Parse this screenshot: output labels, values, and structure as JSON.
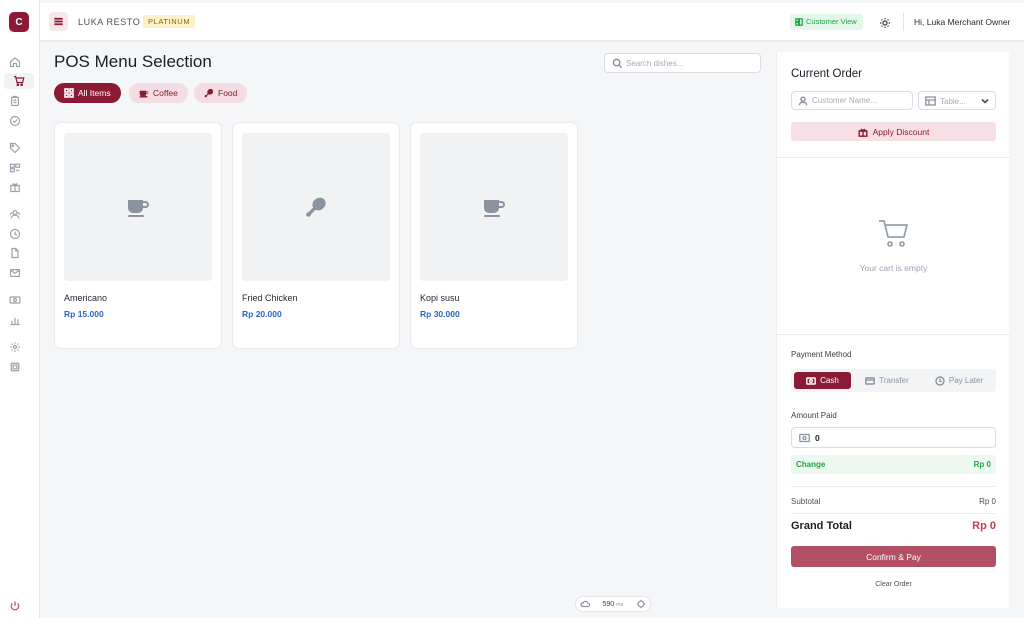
{
  "app": {
    "logo_letter": "C",
    "brand": "LUKA RESTO",
    "tier": "PLATINUM",
    "customer_view": "Customer View",
    "greeting": "Hi, Luka Merchant Owner"
  },
  "sidebar": {
    "items": [
      {
        "icon": "home-icon"
      },
      {
        "icon": "cart-icon",
        "active": true
      },
      {
        "icon": "clipboard-icon"
      },
      {
        "icon": "check-circle-icon"
      },
      {
        "icon": "tag-icon"
      },
      {
        "icon": "grid-icon"
      },
      {
        "icon": "gift-icon"
      },
      {
        "icon": "users-icon"
      },
      {
        "icon": "clock-icon"
      },
      {
        "icon": "document-icon"
      },
      {
        "icon": "mail-icon"
      },
      {
        "icon": "cash-icon"
      },
      {
        "icon": "bar-chart-icon"
      },
      {
        "icon": "settings-icon"
      },
      {
        "icon": "chip-icon"
      },
      {
        "icon": "power-icon"
      }
    ]
  },
  "main": {
    "title": "POS Menu Selection",
    "search_placeholder": "Search dishes...",
    "categories": [
      {
        "label": "All Items",
        "icon": "grid-icon",
        "active": true
      },
      {
        "label": "Coffee",
        "icon": "coffee-icon",
        "active": false
      },
      {
        "label": "Food",
        "icon": "drumstick-icon",
        "active": false
      }
    ],
    "products": [
      {
        "name": "Americano",
        "price": "Rp 15.000",
        "icon": "coffee-icon"
      },
      {
        "name": "Fried Chicken",
        "price": "Rp 20.000",
        "icon": "drumstick-icon"
      },
      {
        "name": "Kopi susu",
        "price": "Rp 30.000",
        "icon": "coffee-icon"
      }
    ],
    "status": {
      "value": "590",
      "unit": "ms"
    }
  },
  "order": {
    "title": "Current Order",
    "customer_placeholder": "Customer Name...",
    "table_placeholder": "Table...",
    "discount_label": "Apply Discount",
    "empty_text": "Your cart is empty",
    "payment_method_label": "Payment Method",
    "payment_methods": [
      {
        "label": "Cash",
        "icon": "cash-icon",
        "active": true
      },
      {
        "label": "Transfer",
        "icon": "card-icon",
        "active": false
      },
      {
        "label": "Pay Later",
        "icon": "clock-icon",
        "active": false
      }
    ],
    "amount_paid_label": "Amount Paid",
    "amount_paid_value": "0",
    "change_label": "Change",
    "change_value": "Rp 0",
    "subtotal_label": "Subtotal",
    "subtotal_value": "Rp 0",
    "grand_total_label": "Grand Total",
    "grand_total_value": "Rp 0",
    "confirm_label": "Confirm & Pay",
    "clear_label": "Clear Order"
  },
  "colors": {
    "brand": "#8b1a35",
    "accent_soft": "#f3dce2",
    "price_blue": "#2b63c8",
    "success": "#22a447",
    "danger": "#d13a4a"
  }
}
